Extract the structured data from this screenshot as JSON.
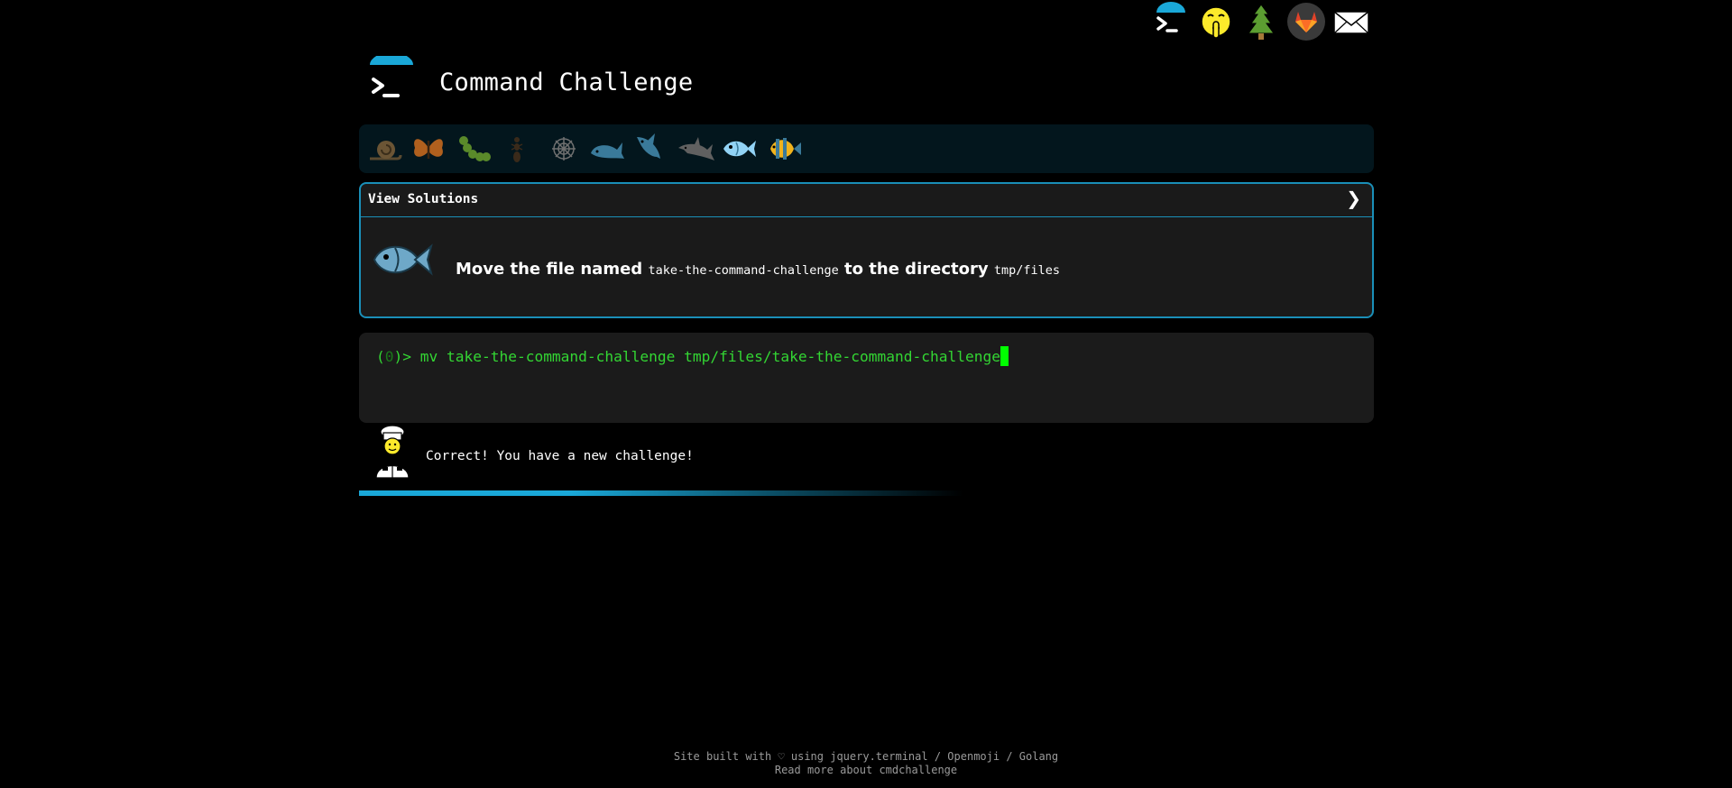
{
  "header": {
    "title": "Command Challenge",
    "top_icons": [
      "terminal-logo-icon",
      "shushing-face-icon",
      "tree-icon",
      "gitlab-icon",
      "envelope-icon"
    ]
  },
  "levels": {
    "icons": [
      "snail-icon",
      "butterfly-icon",
      "caterpillar-icon",
      "ant-icon",
      "spider-web-icon",
      "whale-icon",
      "shark-icon",
      "dolphin-icon",
      "fish-icon",
      "tropical-fish-icon"
    ],
    "active_index": 8
  },
  "challenge": {
    "view_solutions_label": "View Solutions",
    "chevron": "❯",
    "text_before": "Move the file named ",
    "file_name": "take-the-command-challenge",
    "text_middle": " to the directory ",
    "directory": "tmp/files"
  },
  "terminal": {
    "prompt_open": "(",
    "prompt_count": "0",
    "prompt_close": ")> ",
    "command": "mv take-the-command-challenge tmp/files/take-the-command-challenge"
  },
  "status": {
    "message": "Correct! You have a new challenge!"
  },
  "footer": {
    "line1_prefix": "Site built with ♡ using ",
    "link_jquery": "jquery.terminal",
    "sep1": " / ",
    "link_openmoji": "Openmoji",
    "sep2": " / ",
    "link_golang": "Golang",
    "line2_prefix": "Read more about ",
    "link_cmdchallenge": "cmdchallenge"
  },
  "colors": {
    "accent": "#1aa8d8",
    "terminal_green": "#33d633",
    "cursor": "#00ff00",
    "panel_bg": "#1a1a1a",
    "level_bar_bg": "#03161d"
  }
}
